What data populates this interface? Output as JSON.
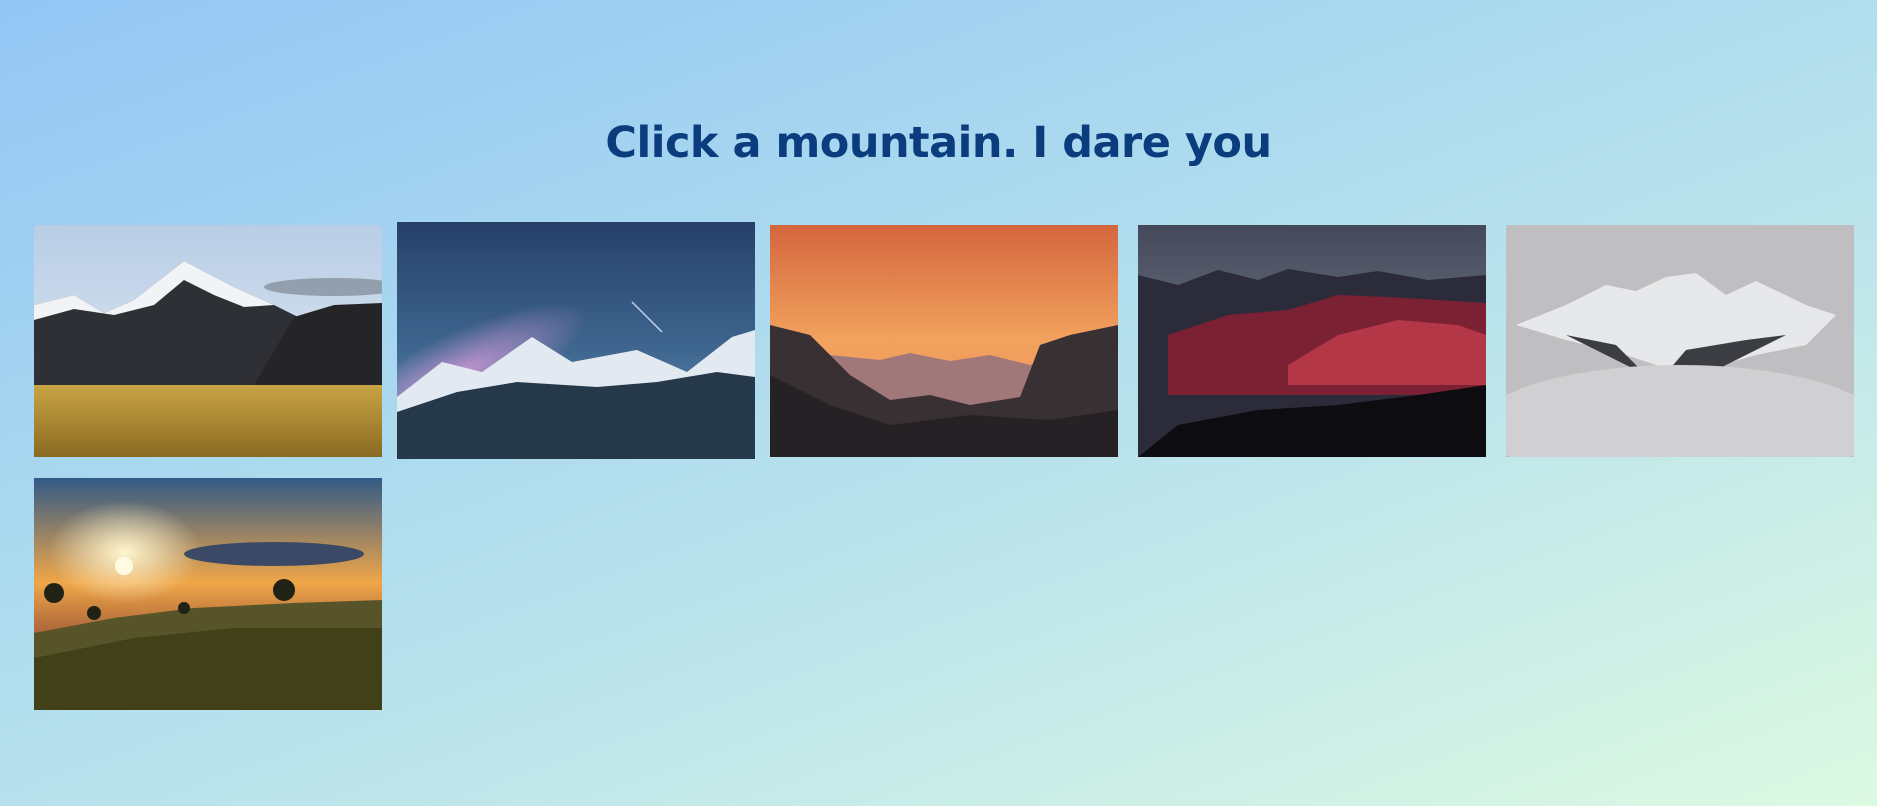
{
  "page": {
    "heading": "Click a mountain. I dare you"
  },
  "gallery": {
    "items": [
      {
        "scene": "snowy-peak-golden-meadow"
      },
      {
        "scene": "milky-way-snowy-ridge"
      },
      {
        "scene": "orange-sunset-peaks"
      },
      {
        "scene": "red-lit-ranges-dusk"
      },
      {
        "scene": "peak-above-clouds"
      },
      {
        "scene": "sunrise-meadow-trees"
      }
    ]
  },
  "colors": {
    "heading": "#0b3d7e"
  }
}
